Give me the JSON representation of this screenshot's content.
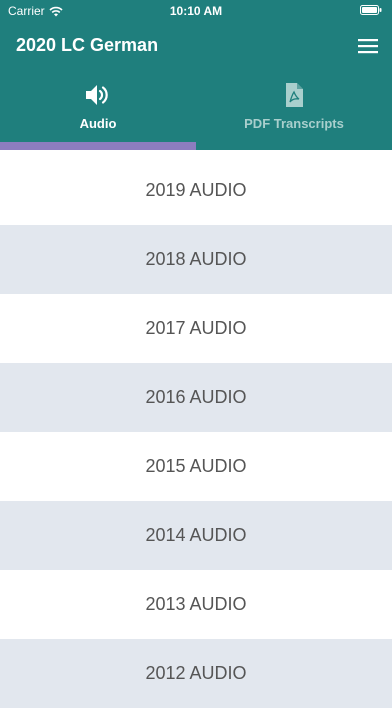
{
  "status_bar": {
    "carrier": "Carrier",
    "time": "10:10 AM"
  },
  "header": {
    "title": "2020 LC German",
    "menu_icon": "hamburger-menu-icon",
    "background_color": "#1f7f7d"
  },
  "tabs": [
    {
      "label": "Audio",
      "icon": "speaker-icon",
      "active": true
    },
    {
      "label": "PDF Transcripts",
      "icon": "pdf-file-icon",
      "active": false
    }
  ],
  "tab_indicator_color": "#8c7dbf",
  "audio_list": [
    {
      "label": "2019 AUDIO"
    },
    {
      "label": "2018 AUDIO"
    },
    {
      "label": "2017 AUDIO"
    },
    {
      "label": "2016 AUDIO"
    },
    {
      "label": "2015 AUDIO"
    },
    {
      "label": "2014 AUDIO"
    },
    {
      "label": "2013 AUDIO"
    },
    {
      "label": "2012 AUDIO"
    }
  ]
}
